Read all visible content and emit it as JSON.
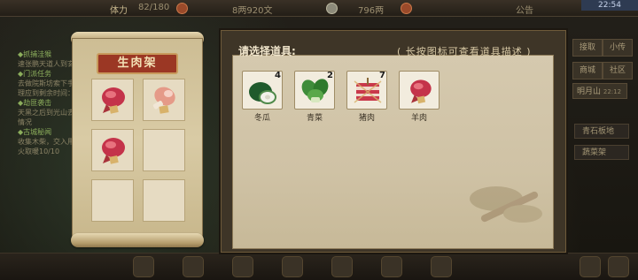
{
  "topbar": {
    "stamina_label": "体力",
    "stamina_value": "82/180",
    "money": "8两920文",
    "silver": "796两",
    "notice": "公告",
    "time": "22:54"
  },
  "quests": [
    {
      "title": "◆抓捕洼猴",
      "text": "速张鹏天道人到玄水堂"
    },
    {
      "title": "◆门派任务",
      "text": "去做院斯坊索下手-查理应到剩余时间：58"
    },
    {
      "title": "◆劫匪袭击",
      "text": "天黑之后到光山去查看情况"
    },
    {
      "title": "◆古城秘闻",
      "text": "收集木柴，交入用来生火取暖10/10"
    }
  ],
  "right_menu": {
    "btn1": "接取",
    "btn2": "小传",
    "btn3": "商城",
    "btn4": "社区",
    "location": "明月山",
    "location_time": "22:12",
    "side1": "青石板地",
    "side2": "蔬菜架"
  },
  "rack": {
    "title": "生肉架",
    "slots": [
      {
        "icon": "mutton-icon"
      },
      {
        "icon": "ham-icon"
      },
      {
        "icon": "mutton-icon"
      },
      {
        "icon": ""
      },
      {
        "icon": ""
      },
      {
        "icon": ""
      }
    ]
  },
  "dialog": {
    "title": "请选择道具:",
    "hint": "( 长按图标可查看道具描述 )",
    "items": [
      {
        "name": "冬瓜",
        "qty": "4",
        "icon": "winter-melon-icon"
      },
      {
        "name": "青菜",
        "qty": "2",
        "icon": "greens-icon"
      },
      {
        "name": "猪肉",
        "qty": "7",
        "icon": "pork-icon"
      },
      {
        "name": "羊肉",
        "qty": "",
        "icon": "mutton-icon"
      }
    ]
  },
  "colors": {
    "accent_red": "#9b3724",
    "paper": "#d5c9ae",
    "panel": "#3e3527"
  }
}
